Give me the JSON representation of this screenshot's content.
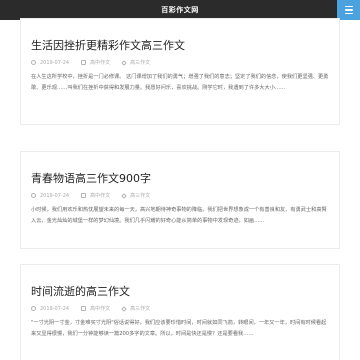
{
  "header": {
    "site_title": "百彩作文网"
  },
  "posts": [
    {
      "title": "生活因挫折更精彩作文高三作文",
      "date": "2019-07-24",
      "category": "高中作文",
      "tag": "高三作文",
      "excerpt": "在人生这所学校中，挫折是一门必修课。 这门课增加了我们的勇气；增强了我们的意志；坚定了我们的信念，使我们更坚强、更勇敢、更乐观……叫我们在挫折中获得和发展力量。我愿好问乐，喜欢挑战。刚学它时，我遇到了许多大大小……"
    },
    {
      "title": "青春物语高三作文900字",
      "date": "2019-07-24",
      "category": "高中作文",
      "tag": "高三作文",
      "excerpt": "小时候，我们用欢乐和热忱展望未来的每一天，高兴地期待神奇事物的降临。我们把世界想象成一个有善良和友、有勇武士和高臂入云、金光灿灿的城堡一样的梦幻仙境。我们几乎闪耀的好奇心能从简单的事物中发现奇迹，如画……"
    },
    {
      "title": "时间流逝的高三作文",
      "date": "2019-07-24",
      "category": "高中作文",
      "tag": "高三作文",
      "excerpt": "\"一寸光阴一寸金，寸金难买寸光阴\"俗话说得好，我们应该要珍惜时间，时间就如同飞箭，转眼间，一年又一年，时间有时候看起来又显得很慢，我们一分钟能够读一篇200多字的文章。所以，时间是快还是慢？还是要看我……"
    }
  ]
}
